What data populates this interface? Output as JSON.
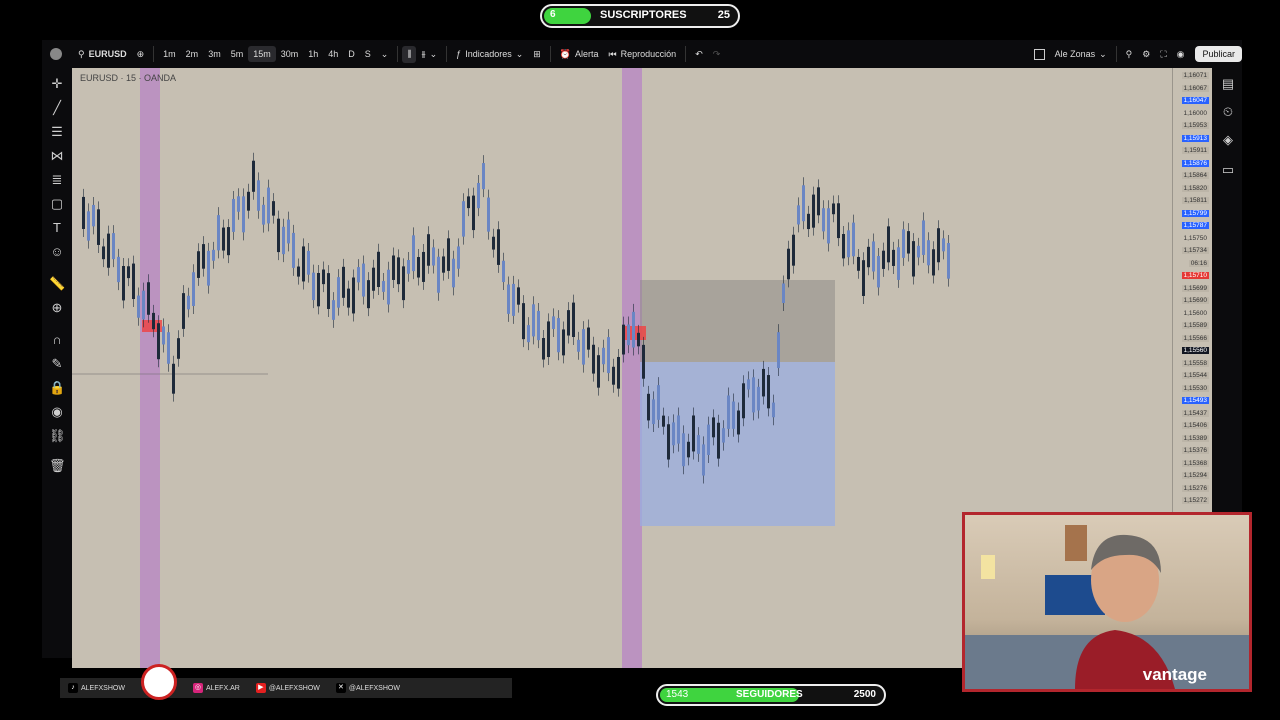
{
  "subscribers": {
    "label": "SUSCRIPTORES",
    "current": "6",
    "goal": "25",
    "progress": 0.24
  },
  "toolbar": {
    "symbol": "EURUSD",
    "timeframes": [
      "1m",
      "2m",
      "3m",
      "5m",
      "15m",
      "30m",
      "1h",
      "4h",
      "D",
      "S"
    ],
    "selected_timeframe": "15m",
    "indicators_label": "Indicadores",
    "alert_label": "Alerta",
    "replay_label": "Reproducción",
    "layout_name": "Ale Zonas",
    "publish_label": "Publicar"
  },
  "chart": {
    "symbol_line": "EURUSD · 15 · OANDA",
    "price_labels": [
      {
        "text": "1,16071",
        "style": "gray"
      },
      {
        "text": "1,16067",
        "style": "gray"
      },
      {
        "text": "1,16047",
        "style": "blue"
      },
      {
        "text": "1,16000",
        "style": "none"
      },
      {
        "text": "1,15953",
        "style": "gray"
      },
      {
        "text": "1,15913",
        "style": "blue"
      },
      {
        "text": "1,15911",
        "style": "gray"
      },
      {
        "text": "1,15876",
        "style": "blue"
      },
      {
        "text": "1,15864",
        "style": "gray"
      },
      {
        "text": "1,15820",
        "style": "gray"
      },
      {
        "text": "1,15811",
        "style": "gray"
      },
      {
        "text": "1,15799",
        "style": "blue"
      },
      {
        "text": "1,15787",
        "style": "blue"
      },
      {
        "text": "1,15750",
        "style": "none"
      },
      {
        "text": "1,15734",
        "style": "gray"
      },
      {
        "text": "06:16",
        "style": "gray"
      },
      {
        "text": "1,15710",
        "style": "red"
      },
      {
        "text": "1,15699",
        "style": "gray"
      },
      {
        "text": "1,15690",
        "style": "gray"
      },
      {
        "text": "1,15600",
        "style": "none"
      },
      {
        "text": "1,15589",
        "style": "gray"
      },
      {
        "text": "1,15566",
        "style": "gray"
      },
      {
        "text": "1,15560",
        "style": "dark"
      },
      {
        "text": "1,15558",
        "style": "gray"
      },
      {
        "text": "1,15544",
        "style": "gray"
      },
      {
        "text": "1,15530",
        "style": "gray"
      },
      {
        "text": "1,15493",
        "style": "blue"
      },
      {
        "text": "1,15437",
        "style": "gray"
      },
      {
        "text": "1,15406",
        "style": "gray"
      },
      {
        "text": "1,15389",
        "style": "gray"
      },
      {
        "text": "1,15376",
        "style": "gray"
      },
      {
        "text": "1,15368",
        "style": "gray"
      },
      {
        "text": "1,15294",
        "style": "gray"
      },
      {
        "text": "1,15276",
        "style": "gray"
      },
      {
        "text": "1,15272",
        "style": "gray"
      }
    ]
  },
  "webcam": {
    "brand": "vantage"
  },
  "social": [
    {
      "icon": "tiktok-icon",
      "color": "#000000",
      "handle": "ALEFXSHOW"
    },
    {
      "icon": "instagram-icon",
      "color": "#d6247a",
      "handle": "ALEFX.AR"
    },
    {
      "icon": "youtube-icon",
      "color": "#e52020",
      "handle": "@ALEFXSHOW"
    },
    {
      "icon": "x-icon",
      "color": "#000000",
      "handle": "@ALEFXSHOW"
    }
  ],
  "followers": {
    "label": "SEGUIDORES",
    "current": "1543",
    "goal": "2500",
    "progress": 0.617
  }
}
